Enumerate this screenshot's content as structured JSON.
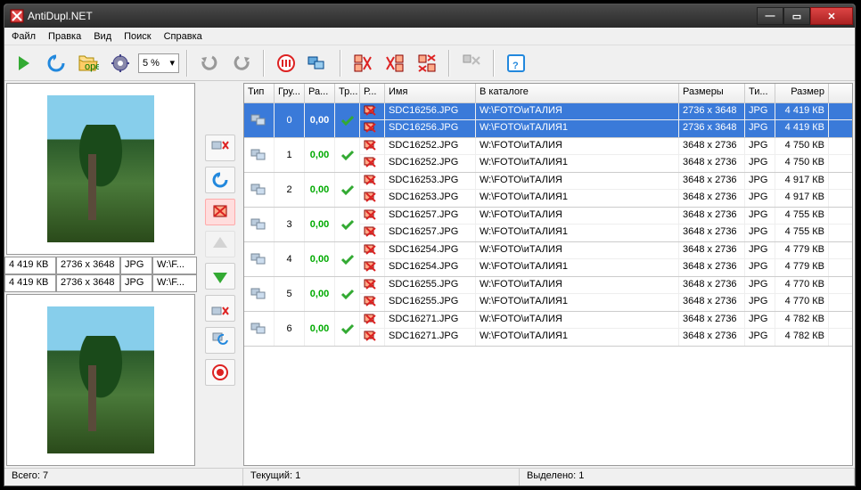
{
  "title": "AntiDupl.NET",
  "menu": {
    "file": "Файл",
    "edit": "Правка",
    "view": "Вид",
    "search": "Поиск",
    "help": "Справка"
  },
  "percent": "5 %",
  "columns": {
    "type": "Тип",
    "group": "Гру...",
    "diff": "Ра...",
    "tr": "Тр...",
    "r": "Р...",
    "name": "Имя",
    "path": "В каталоге",
    "dim": "Размеры",
    "ext": "Ти...",
    "size": "Размер"
  },
  "left": {
    "top": {
      "size": "4 419 КВ",
      "dim": "2736 x 3648",
      "ext": "JPG",
      "path": "W:\\F..."
    },
    "bottom": {
      "size": "4 419 КВ",
      "dim": "2736 x 3648",
      "ext": "JPG",
      "path": "W:\\F..."
    }
  },
  "groups": [
    {
      "idx": 0,
      "diff": "0,00",
      "selected": true,
      "rows": [
        {
          "name": "SDC16256.JPG",
          "path": "W:\\FOTO\\иТАЛИЯ",
          "dim": "2736 x 3648",
          "ext": "JPG",
          "size": "4 419 КВ"
        },
        {
          "name": "SDC16256.JPG",
          "path": "W:\\FOTO\\иТАЛИЯ1",
          "dim": "2736 x 3648",
          "ext": "JPG",
          "size": "4 419 КВ"
        }
      ]
    },
    {
      "idx": 1,
      "diff": "0,00",
      "selected": false,
      "rows": [
        {
          "name": "SDC16252.JPG",
          "path": "W:\\FOTO\\иТАЛИЯ",
          "dim": "3648 x 2736",
          "ext": "JPG",
          "size": "4 750 КВ"
        },
        {
          "name": "SDC16252.JPG",
          "path": "W:\\FOTO\\иТАЛИЯ1",
          "dim": "3648 x 2736",
          "ext": "JPG",
          "size": "4 750 КВ"
        }
      ]
    },
    {
      "idx": 2,
      "diff": "0,00",
      "selected": false,
      "rows": [
        {
          "name": "SDC16253.JPG",
          "path": "W:\\FOTO\\иТАЛИЯ",
          "dim": "3648 x 2736",
          "ext": "JPG",
          "size": "4 917 КВ"
        },
        {
          "name": "SDC16253.JPG",
          "path": "W:\\FOTO\\иТАЛИЯ1",
          "dim": "3648 x 2736",
          "ext": "JPG",
          "size": "4 917 КВ"
        }
      ]
    },
    {
      "idx": 3,
      "diff": "0,00",
      "selected": false,
      "rows": [
        {
          "name": "SDC16257.JPG",
          "path": "W:\\FOTO\\иТАЛИЯ",
          "dim": "3648 x 2736",
          "ext": "JPG",
          "size": "4 755 КВ"
        },
        {
          "name": "SDC16257.JPG",
          "path": "W:\\FOTO\\иТАЛИЯ1",
          "dim": "3648 x 2736",
          "ext": "JPG",
          "size": "4 755 КВ"
        }
      ]
    },
    {
      "idx": 4,
      "diff": "0,00",
      "selected": false,
      "rows": [
        {
          "name": "SDC16254.JPG",
          "path": "W:\\FOTO\\иТАЛИЯ",
          "dim": "3648 x 2736",
          "ext": "JPG",
          "size": "4 779 КВ"
        },
        {
          "name": "SDC16254.JPG",
          "path": "W:\\FOTO\\иТАЛИЯ1",
          "dim": "3648 x 2736",
          "ext": "JPG",
          "size": "4 779 КВ"
        }
      ]
    },
    {
      "idx": 5,
      "diff": "0,00",
      "selected": false,
      "rows": [
        {
          "name": "SDC16255.JPG",
          "path": "W:\\FOTO\\иТАЛИЯ",
          "dim": "3648 x 2736",
          "ext": "JPG",
          "size": "4 770 КВ"
        },
        {
          "name": "SDC16255.JPG",
          "path": "W:\\FOTO\\иТАЛИЯ1",
          "dim": "3648 x 2736",
          "ext": "JPG",
          "size": "4 770 КВ"
        }
      ]
    },
    {
      "idx": 6,
      "diff": "0,00",
      "selected": false,
      "rows": [
        {
          "name": "SDC16271.JPG",
          "path": "W:\\FOTO\\иТАЛИЯ",
          "dim": "3648 x 2736",
          "ext": "JPG",
          "size": "4 782 КВ"
        },
        {
          "name": "SDC16271.JPG",
          "path": "W:\\FOTO\\иТАЛИЯ1",
          "dim": "3648 x 2736",
          "ext": "JPG",
          "size": "4 782 КВ"
        }
      ]
    }
  ],
  "status": {
    "total": "Всего: 7",
    "current": "Текущий: 1",
    "selected": "Выделено: 1"
  }
}
